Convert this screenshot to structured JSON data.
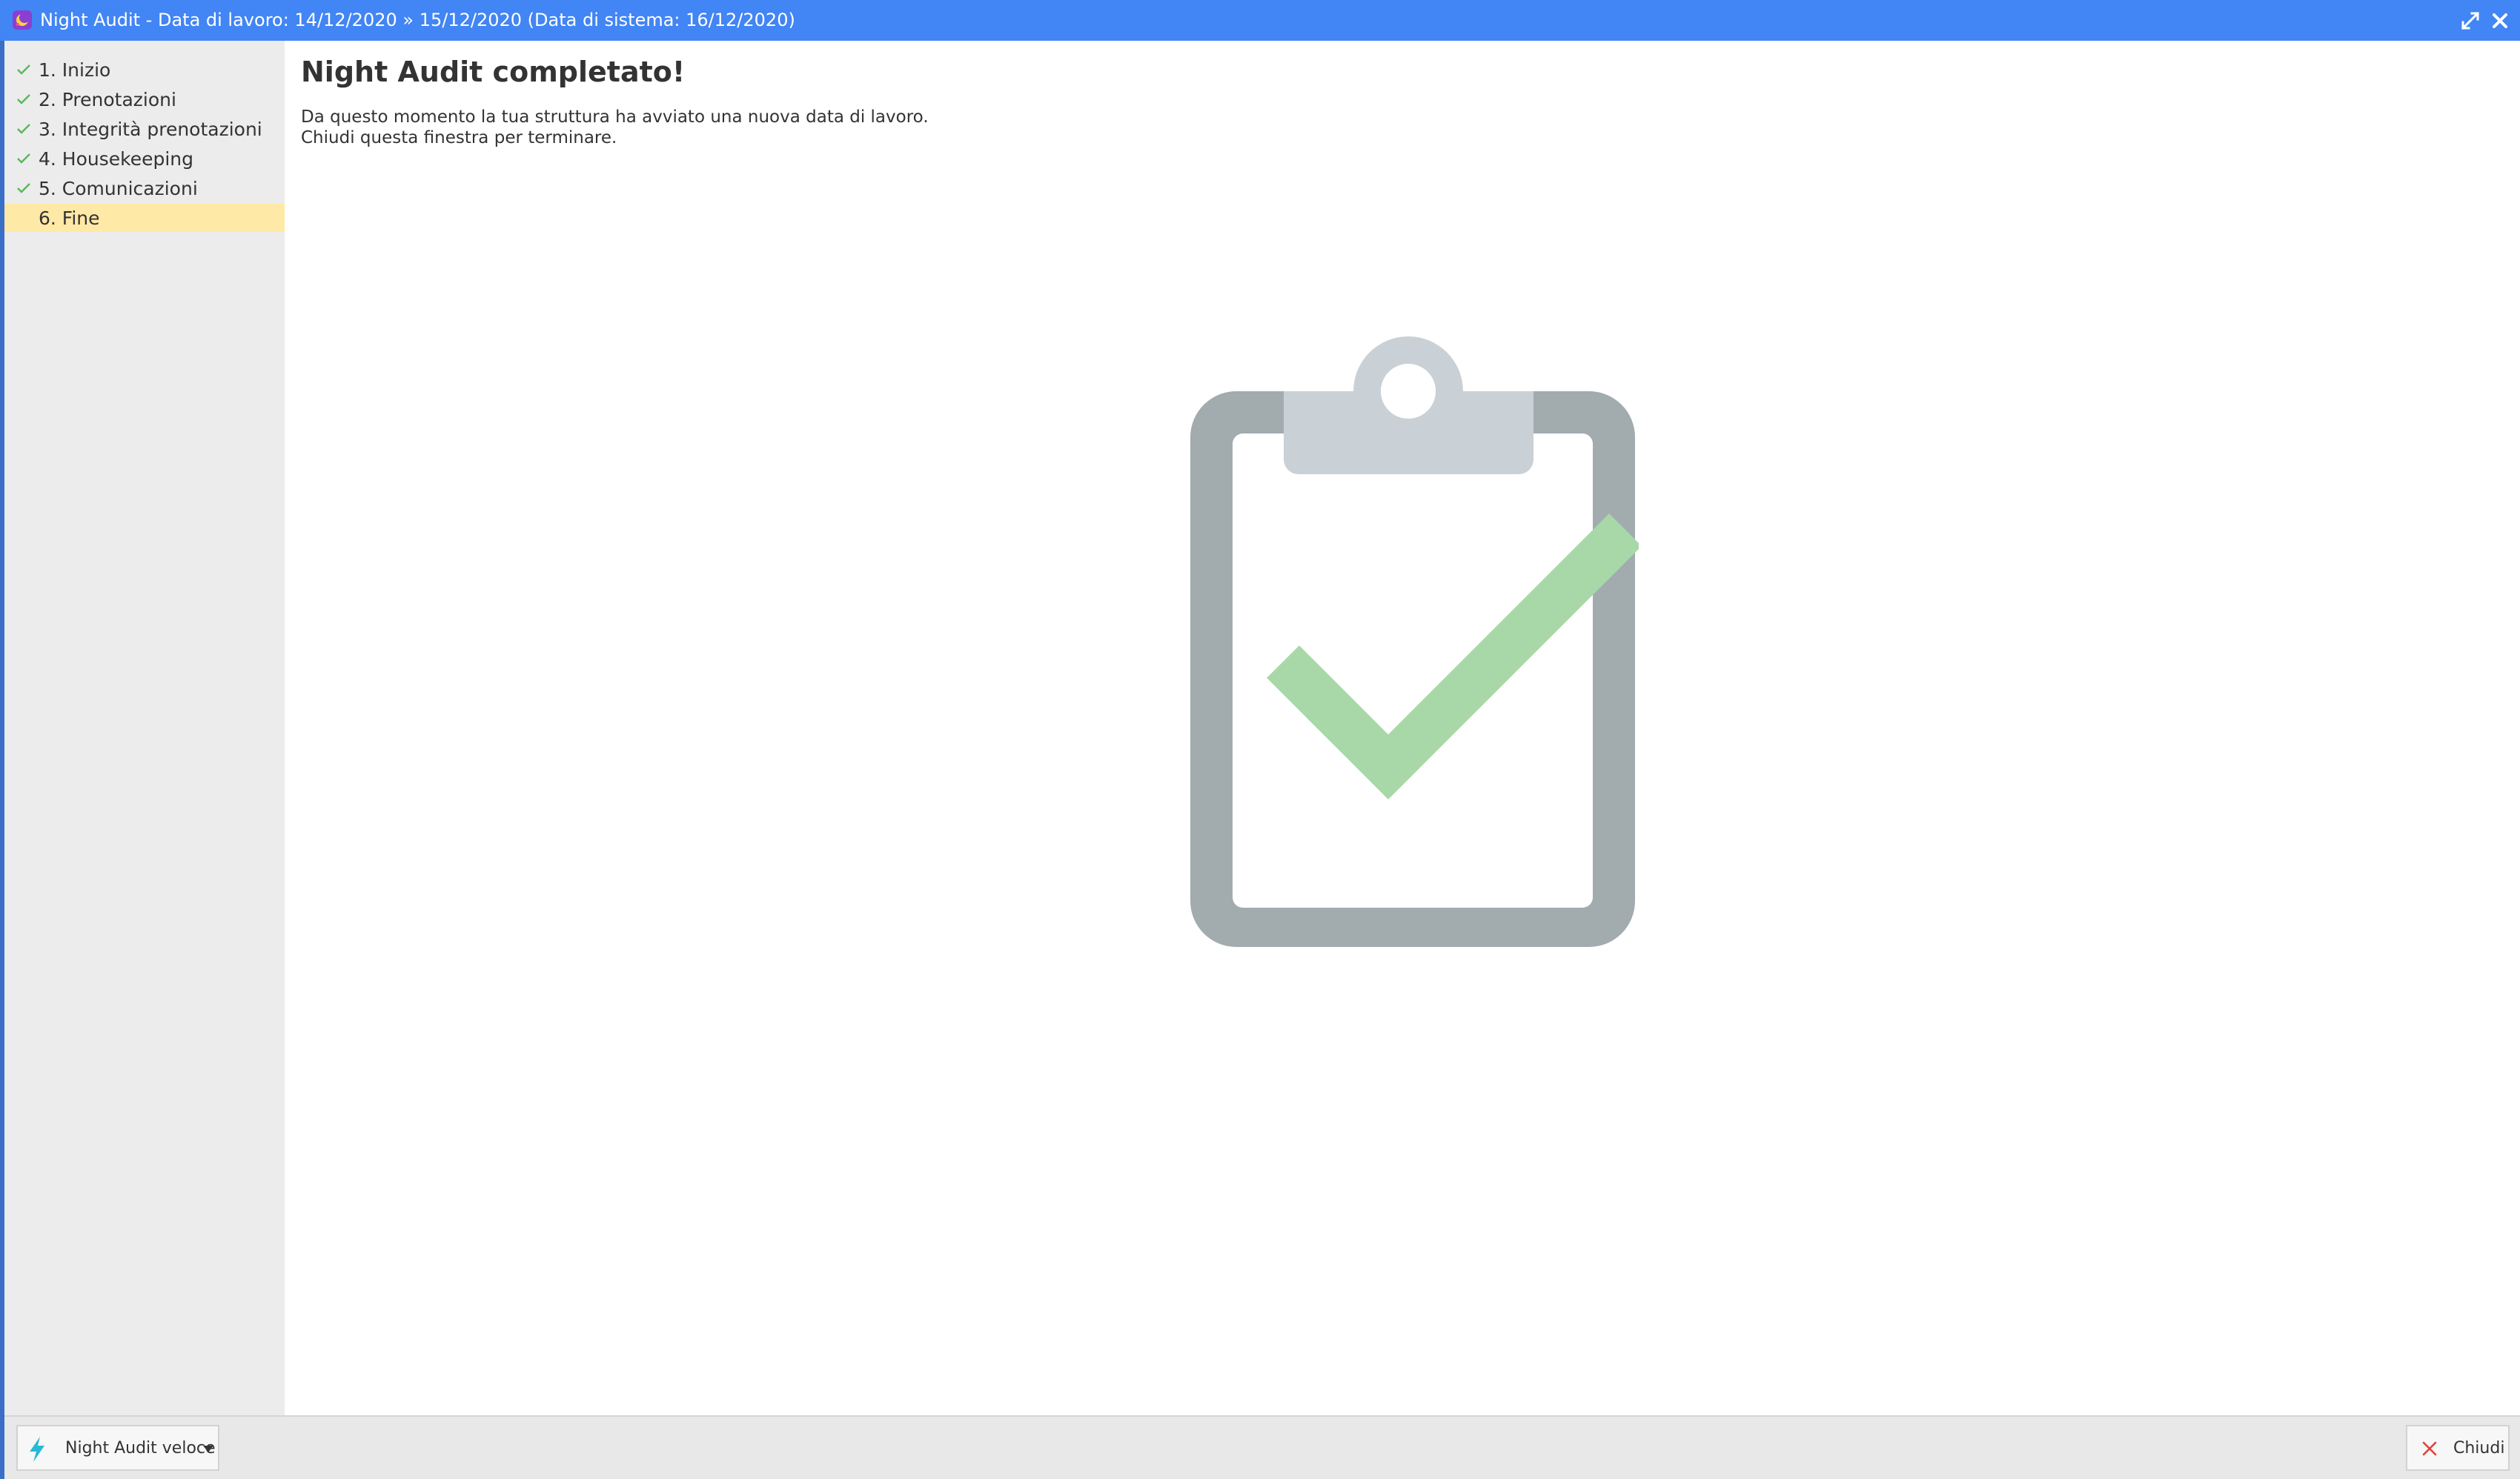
{
  "window": {
    "title": "Night Audit - Data di lavoro: 14/12/2020 » 15/12/2020 (Data di sistema: 16/12/2020)",
    "maximize_icon": "maximize-icon",
    "close_icon": "close-icon"
  },
  "sidebar": {
    "steps": [
      {
        "label": "1. Inizio",
        "completed": true
      },
      {
        "label": "2. Prenotazioni",
        "completed": true
      },
      {
        "label": "3. Integrità prenotazioni",
        "completed": true
      },
      {
        "label": "4. Housekeeping",
        "completed": true
      },
      {
        "label": "5. Comunicazioni",
        "completed": true
      },
      {
        "label": "6. Fine",
        "completed": false,
        "active": true
      }
    ]
  },
  "content": {
    "heading": "Night Audit completato!",
    "message_line1": "Da questo momento la tua struttura ha avviato una nuova data di lavoro.",
    "message_line2": "Chiudi questa finestra per terminare.",
    "illustration": "clipboard-check-icon"
  },
  "footer": {
    "fast_audit_label": "Night Audit veloce",
    "close_label": "Chiudi"
  },
  "colors": {
    "titlebar": "#4285f4",
    "sidebar_bg": "#ececec",
    "active_step_bg": "#ffe9a6",
    "check_green": "#5cb85c",
    "clipboard_frame": "#a2acaf",
    "clipboard_clip": "#c9d1d6",
    "big_check": "#a8d8a8",
    "bolt": "#28b8d8",
    "close_x": "#e0413a"
  }
}
